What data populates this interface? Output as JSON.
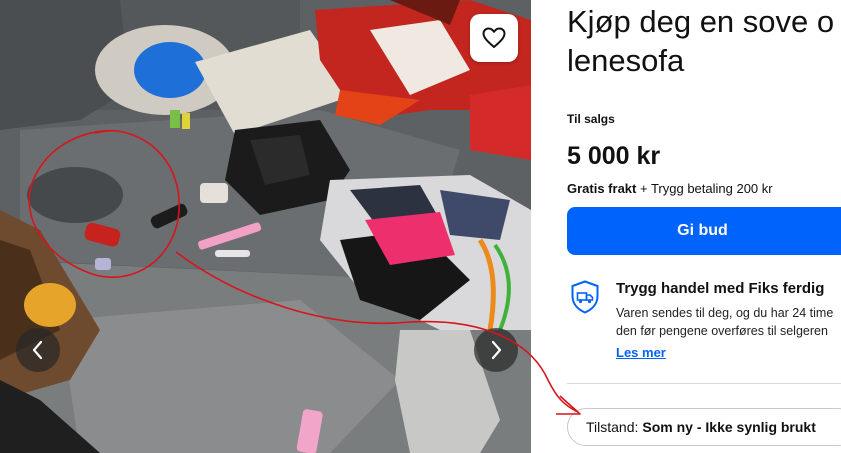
{
  "gallery": {
    "image_alt": "Photo of a grey sofa with clutter",
    "prev_icon": "chevron-left-icon",
    "next_icon": "chevron-right-icon",
    "favorite_icon": "heart-icon"
  },
  "listing": {
    "title_line1": "Kjøp deg en sove o",
    "title_line2": "lenesofa",
    "status": "Til salgs",
    "price": "5 000 kr",
    "shipping_bold": "Gratis frakt",
    "shipping_rest": " + Trygg betaling 200 kr",
    "bid_label": "Gi bud"
  },
  "fiks": {
    "icon": "shield-truck-icon",
    "title": "Trygg handel med Fiks ferdig",
    "desc_line1": "Varen sendes til deg, og du har 24 time",
    "desc_line2": "den før pengene overføres til selgeren",
    "link": "Les mer"
  },
  "condition": {
    "label": "Tilstand:",
    "value": "Som ny - Ikke synlig brukt"
  },
  "colors": {
    "accent": "#0063fb",
    "annotation": "#d8141c"
  }
}
